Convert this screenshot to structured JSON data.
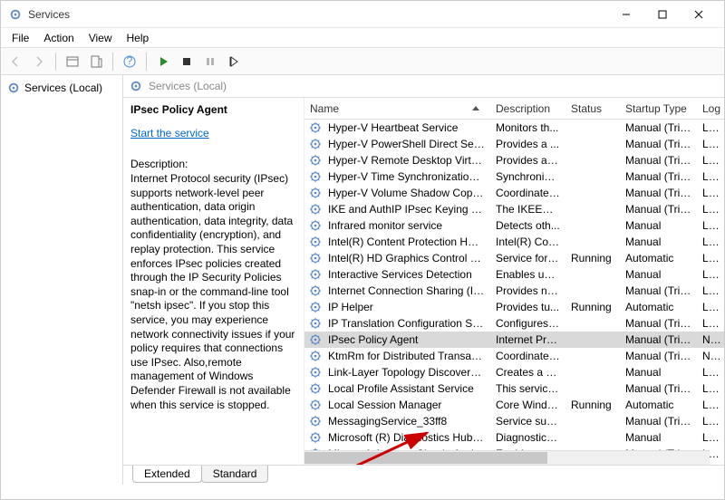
{
  "window": {
    "title": "Services",
    "controls": {
      "minimize": "—",
      "maximize": "□",
      "close": "×"
    }
  },
  "menubar": [
    "File",
    "Action",
    "View",
    "Help"
  ],
  "nav": {
    "item": "Services (Local)"
  },
  "content": {
    "header": "Services (Local)"
  },
  "detail": {
    "name": "IPsec Policy Agent",
    "action": "Start the service",
    "desc_label": "Description:",
    "description": "Internet Protocol security (IPsec) supports network-level peer authentication, data origin authentication, data integrity, data confidentiality (encryption), and replay protection.  This service enforces IPsec policies created through the IP Security Policies snap-in or the command-line tool \"netsh ipsec\".  If you stop this service, you may experience network connectivity issues if your policy requires that connections use IPsec.  Also,remote management of Windows Defender Firewall is not available when this service is stopped."
  },
  "columns": {
    "name": "Name",
    "description": "Description",
    "status": "Status",
    "startup": "Startup Type",
    "logon": "Log"
  },
  "services": [
    {
      "name": "Hyper-V Heartbeat Service",
      "desc": "Monitors th...",
      "status": "",
      "startup": "Manual (Trig...",
      "logon": "Loc"
    },
    {
      "name": "Hyper-V PowerShell Direct Service",
      "desc": "Provides a ...",
      "status": "",
      "startup": "Manual (Trig...",
      "logon": "Loc"
    },
    {
      "name": "Hyper-V Remote Desktop Virtualiz...",
      "desc": "Provides a p...",
      "status": "",
      "startup": "Manual (Trig...",
      "logon": "Loc"
    },
    {
      "name": "Hyper-V Time Synchronization Serv...",
      "desc": "Synchronize...",
      "status": "",
      "startup": "Manual (Trig...",
      "logon": "Loc"
    },
    {
      "name": "Hyper-V Volume Shadow Copy Re...",
      "desc": "Coordinates...",
      "status": "",
      "startup": "Manual (Trig...",
      "logon": "Loc"
    },
    {
      "name": "IKE and AuthIP IPsec Keying Modu...",
      "desc": "The IKEEXT ...",
      "status": "",
      "startup": "Manual (Trig...",
      "logon": "Loc"
    },
    {
      "name": "Infrared monitor service",
      "desc": "Detects oth...",
      "status": "",
      "startup": "Manual",
      "logon": "Loc"
    },
    {
      "name": "Intel(R) Content Protection HECI S...",
      "desc": "Intel(R) Con...",
      "status": "",
      "startup": "Manual",
      "logon": "Loc"
    },
    {
      "name": "Intel(R) HD Graphics Control Panel...",
      "desc": "Service for I...",
      "status": "Running",
      "startup": "Automatic",
      "logon": "Loc"
    },
    {
      "name": "Interactive Services Detection",
      "desc": "Enables use...",
      "status": "",
      "startup": "Manual",
      "logon": "Loc"
    },
    {
      "name": "Internet Connection Sharing (ICS)",
      "desc": "Provides ne...",
      "status": "",
      "startup": "Manual (Trig...",
      "logon": "Loc"
    },
    {
      "name": "IP Helper",
      "desc": "Provides tu...",
      "status": "Running",
      "startup": "Automatic",
      "logon": "Loc"
    },
    {
      "name": "IP Translation Configuration Service",
      "desc": "Configures ...",
      "status": "",
      "startup": "Manual (Trig...",
      "logon": "Loc"
    },
    {
      "name": "IPsec Policy Agent",
      "desc": "Internet Pro...",
      "status": "",
      "startup": "Manual (Trig...",
      "logon": "Net",
      "selected": true
    },
    {
      "name": "KtmRm for Distributed Transaction...",
      "desc": "Coordinates...",
      "status": "",
      "startup": "Manual (Trig...",
      "logon": "Net"
    },
    {
      "name": "Link-Layer Topology Discovery Ma...",
      "desc": "Creates a N...",
      "status": "",
      "startup": "Manual",
      "logon": "Loc"
    },
    {
      "name": "Local Profile Assistant Service",
      "desc": "This service ...",
      "status": "",
      "startup": "Manual (Trig...",
      "logon": "Loc"
    },
    {
      "name": "Local Session Manager",
      "desc": "Core Windo...",
      "status": "Running",
      "startup": "Automatic",
      "logon": "Loc"
    },
    {
      "name": "MessagingService_33ff8",
      "desc": "Service sup...",
      "status": "",
      "startup": "Manual (Trig...",
      "logon": "Loc"
    },
    {
      "name": "Microsoft (R) Diagnostics Hub Sta...",
      "desc": "Diagnostics ...",
      "status": "",
      "startup": "Manual",
      "logon": "Loc"
    },
    {
      "name": "Microsoft Account Sign-in Assistant",
      "desc": "Enables use...",
      "status": "",
      "startup": "Manual (Trig...",
      "logon": "Loc"
    }
  ],
  "tabs": {
    "extended": "Extended",
    "standard": "Standard"
  }
}
